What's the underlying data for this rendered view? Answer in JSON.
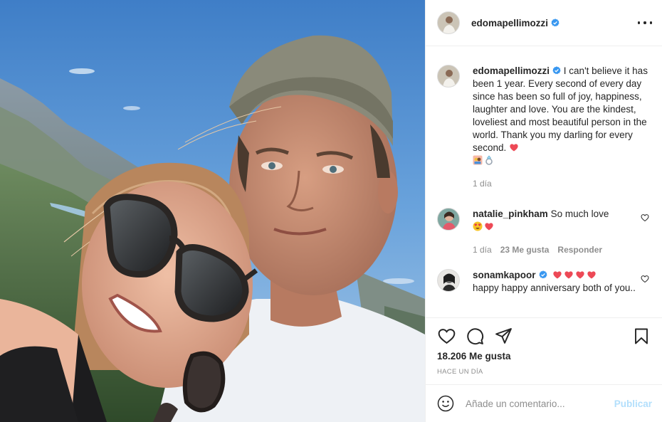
{
  "post": {
    "author": "edomapellimozzi",
    "verified": true,
    "caption": "I can't believe it has been 1 year. Every second of every day since has been so full of joy, happiness, laughter and love. You are the kindest, loveliest and most beautiful person in the world. Thank you my darling for every second.",
    "caption_time": "1 día",
    "image_description": "Selfie of a smiling couple on a mountain top"
  },
  "comments": [
    {
      "user": "natalie_pinkham",
      "verified": false,
      "text": "So much love",
      "time": "1 día",
      "likes": "23 Me gusta",
      "reply_label": "Responder"
    },
    {
      "user": "sonamkapoor",
      "verified": true,
      "text": "happy happy anniversary both of you..",
      "icons": [
        "heart-emoji",
        "heart-emoji",
        "heart-emoji",
        "heart-emoji"
      ]
    }
  ],
  "stats": {
    "likes": "18.206 Me gusta",
    "posted": "HACE UN DÍA"
  },
  "composer": {
    "placeholder": "Añade un comentario...",
    "publish_label": "Publicar"
  },
  "colors": {
    "verified_blue": "#3897f0",
    "heart_red": "#ed4956",
    "publish_disabled": "#b2dffc",
    "secondary_text": "#8e8e8e"
  }
}
